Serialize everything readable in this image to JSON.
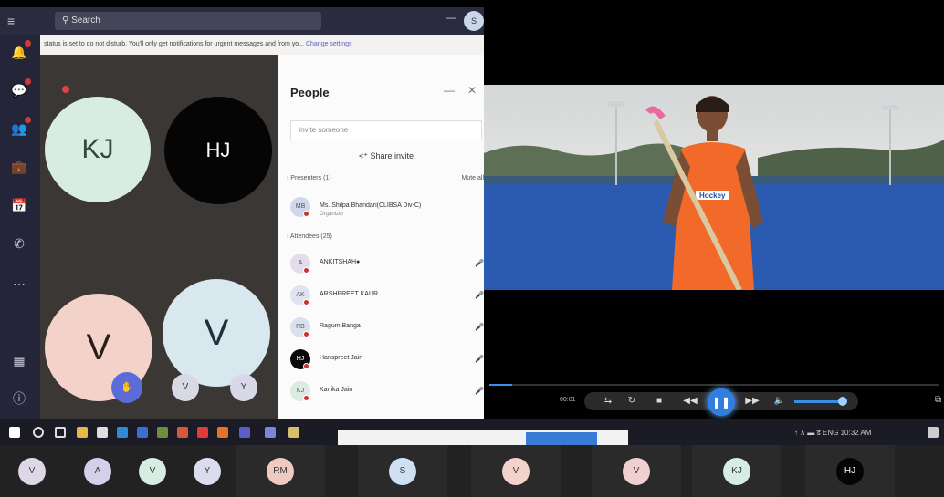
{
  "teams": {
    "search_placeholder": "Search",
    "profile_initials": "S",
    "banner_text": "status is set to do not disturb. You'll only get notifications for urgent messages and from yo...",
    "banner_link": "Change settings"
  },
  "stage": {
    "tiles": [
      {
        "initials": "KJ",
        "bg": "#d7ece2",
        "fg": "#2f4a3f"
      },
      {
        "initials": "HJ",
        "bg": "#050505",
        "fg": "#ffffff"
      },
      {
        "initials": "V",
        "bg": "#f3d2ca",
        "fg": "#2b1d1a"
      },
      {
        "initials": "V",
        "bg": "#d9e8ef",
        "fg": "#203038"
      }
    ],
    "small_avatars": [
      "V",
      "Y"
    ]
  },
  "people": {
    "title": "People",
    "invite_placeholder": "Invite someone",
    "share_label": "Share invite",
    "presenters_header": "Presenters (1)",
    "mute_all": "Mute all",
    "presenters": [
      {
        "initials": "MB",
        "name": "Ms. Shilpa Bhandari(CLIBSA Div-C)",
        "role": "Organizer",
        "bg": "#cfd8ea"
      }
    ],
    "attendees_header": "Attendees (25)",
    "attendees": [
      {
        "initials": "A",
        "name": "ANKITSHAH●",
        "bg": "#e4dcea"
      },
      {
        "initials": "AK",
        "name": "ARSHPREET KAUR",
        "bg": "#dfe3f1"
      },
      {
        "initials": "RB",
        "name": "Ragum Banga",
        "bg": "#d9e0ee"
      },
      {
        "initials": "HJ",
        "name": "Hanspreet Jain",
        "bg": "#0a0a0a"
      },
      {
        "initials": "KJ",
        "name": "Kanika Jain",
        "bg": "#d9ecdf"
      }
    ]
  },
  "video": {
    "jersey_text": "Hockey",
    "time_label": "00:01",
    "progress": 0.05,
    "volume": 0.85
  },
  "taskbar": {
    "tray_text": "↑ ∧ ▬ ड ENG  10:32 AM"
  },
  "strip": {
    "avatars": [
      {
        "initials": "V",
        "bg": "#dfd7e6"
      },
      {
        "initials": "A",
        "bg": "#d3d0ea"
      },
      {
        "initials": "V",
        "bg": "#d7ece2"
      },
      {
        "initials": "Y",
        "bg": "#dcdcef"
      },
      {
        "initials": "RM",
        "bg": "#f0c9c0"
      },
      {
        "initials": "S",
        "bg": "#cfe0f0"
      },
      {
        "initials": "V",
        "bg": "#f3d2ca"
      },
      {
        "initials": "V",
        "bg": "#f0d0d0"
      },
      {
        "initials": "KJ",
        "bg": "#d7ece2"
      },
      {
        "initials": "HJ",
        "bg": "#050505"
      }
    ]
  }
}
